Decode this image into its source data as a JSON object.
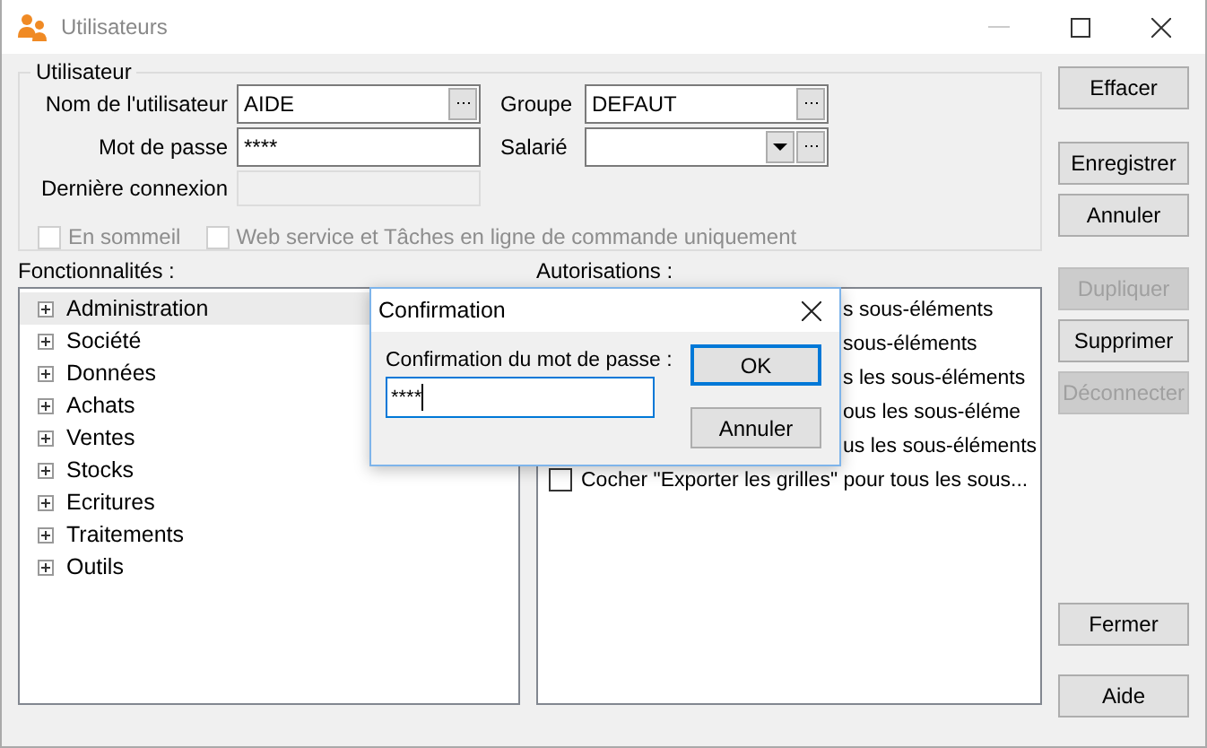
{
  "window": {
    "title": "Utilisateurs"
  },
  "user_group": {
    "title": "Utilisateur",
    "fields": [
      {
        "label": "Nom de l'utilisateur",
        "value": "AIDE",
        "kind": "lookup"
      },
      {
        "label": "Groupe",
        "value": "DEFAUT",
        "kind": "lookup"
      },
      {
        "label": "Mot de passe",
        "value": "****",
        "kind": "text"
      },
      {
        "label": "Salarié",
        "kind": "combo"
      },
      {
        "label": "Dernière connexion",
        "kind": "readonly"
      }
    ],
    "options": [
      {
        "label": "En sommeil",
        "checked": false,
        "disabled": true
      },
      {
        "label": "Web service et Tâches en ligne de commande uniquement",
        "checked": false,
        "disabled": true
      }
    ]
  },
  "features": {
    "label": "Fonctionnalités :",
    "items": [
      {
        "label": "Administration",
        "expanded": false,
        "selected": true
      },
      {
        "label": "Société",
        "expanded": false,
        "selected": false
      },
      {
        "label": "Données",
        "expanded": false,
        "selected": false
      },
      {
        "label": "Achats",
        "expanded": false,
        "selected": false
      },
      {
        "label": "Ventes",
        "expanded": false,
        "selected": false
      },
      {
        "label": "Stocks",
        "expanded": false,
        "selected": false
      },
      {
        "label": "Ecritures",
        "expanded": false,
        "selected": false
      },
      {
        "label": "Traitements",
        "expanded": false,
        "selected": false
      },
      {
        "label": "Outils",
        "expanded": false,
        "selected": false
      }
    ]
  },
  "permissions": {
    "label": "Autorisations :",
    "items": [
      {
        "text": "s sous-éléments",
        "kind": "covered"
      },
      {
        "text": "sous-éléments",
        "kind": "covered"
      },
      {
        "text": "s les sous-éléments",
        "kind": "covered"
      },
      {
        "text": "ous les sous-éléme",
        "kind": "covered"
      },
      {
        "text": "us les sous-éléments",
        "kind": "covered"
      },
      {
        "text": "Cocher \"Exporter les grilles\" pour tous les sous...",
        "kind": "full",
        "checked": false
      }
    ]
  },
  "button_groups": [
    [
      {
        "label": "Effacer",
        "disabled": false
      }
    ],
    [
      {
        "label": "Enregistrer",
        "disabled": false
      },
      {
        "label": "Annuler",
        "disabled": false
      }
    ],
    [
      {
        "label": "Dupliquer",
        "disabled": true
      },
      {
        "label": "Supprimer",
        "disabled": false
      },
      {
        "label": "Déconnecter",
        "disabled": true
      }
    ],
    [
      {
        "label": "Fermer",
        "disabled": false
      }
    ],
    [
      {
        "label": "Aide",
        "disabled": false
      }
    ]
  ],
  "dialog": {
    "title": "Confirmation",
    "label": "Confirmation du mot de passe :",
    "value": "****",
    "buttons": [
      {
        "label": "OK",
        "default": true
      },
      {
        "label": "Annuler",
        "default": false
      }
    ]
  }
}
